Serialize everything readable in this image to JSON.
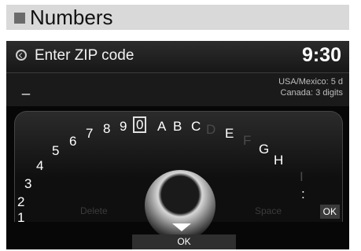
{
  "section": {
    "title": "Numbers"
  },
  "screen": {
    "title": "Enter ZIP code",
    "clock": "9:30",
    "input_value": "_",
    "hint": {
      "line1": "USA/Mexico: 5 d",
      "line2": "Canada: 3 digits"
    }
  },
  "keyboard": {
    "chars": [
      "1",
      "2",
      "3",
      "4",
      "5",
      "6",
      "7",
      "8",
      "9",
      "0",
      "A",
      "B",
      "C",
      "D",
      "E",
      "F",
      "G",
      "H",
      "I",
      ":"
    ],
    "selected": "0",
    "dimmed": [
      "D",
      "F",
      "I"
    ],
    "delete_label": "Delete",
    "space_label": "Space",
    "ok_label": "OK"
  },
  "bottom": {
    "ok_label": "OK"
  }
}
